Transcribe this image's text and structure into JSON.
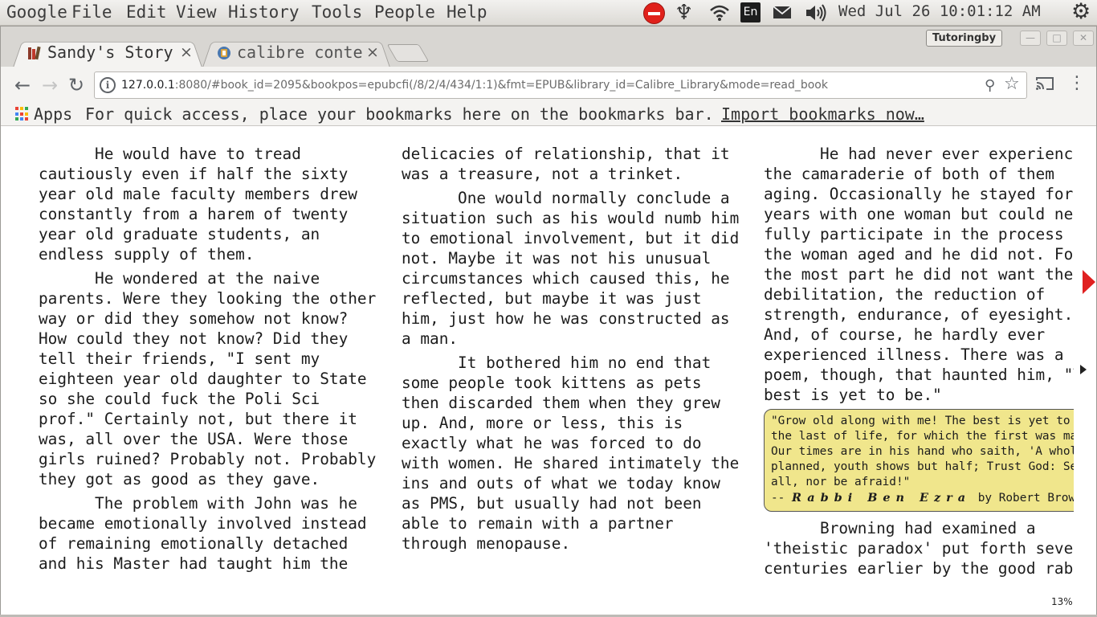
{
  "topbar": {
    "menus": [
      "Google",
      "File",
      "Edit",
      "View",
      "History",
      "Tools",
      "People",
      "Help"
    ],
    "keyboard_layout": "En",
    "clock": "Wed Jul 26 10:01:12 AM",
    "icons": [
      "stop-sign-icon",
      "sync-icon",
      "wifi-icon",
      "keyboard-layout-indicator",
      "mail-icon",
      "volume-icon",
      "system-gear-icon"
    ],
    "stop_color": "#e0211b"
  },
  "tabs": [
    {
      "title": "Sandy's Story",
      "close": "×",
      "active": true,
      "icon": "books-icon"
    },
    {
      "title": "calibre content server",
      "close": "×",
      "active": false,
      "icon": "calibre-icon"
    }
  ],
  "profile_badge": "Tutoringby",
  "window_buttons": {
    "minimize": "—",
    "maximize": "□",
    "close": "✕"
  },
  "toolbar": {
    "url_host": "127.0.0.1",
    "url_rest": ":8080/#book_id=2095&bookpos=epubcfi(/8/2/4/434/1:1)&fmt=EPUB&library_id=Calibre_Library&mode=read_book"
  },
  "bookmarks": {
    "apps_label": "Apps",
    "hint": "For quick access, place your bookmarks here on the bookmarks bar.",
    "import_link": "Import bookmarks now…",
    "apps_colors": [
      "#ea4335",
      "#fbbc05",
      "#34a853",
      "#4285f4",
      "#ea4335",
      "#fbbc05",
      "#34a853",
      "#4285f4",
      "#ea4335"
    ]
  },
  "reader": {
    "col1": [
      [
        "      He would have to tread",
        "cautiously even if half the sixty",
        "year old male faculty members drew",
        "constantly from a harem of twenty",
        "year old graduate students, an",
        "endless supply of them."
      ],
      [
        "      He wondered at the naive",
        "parents. Were they looking the other",
        "way or did they somehow not know?",
        "How could they not know? Did they",
        "tell their friends, \"I sent my",
        "eighteen year old daughter to State",
        "so she could fuck the Poli Sci",
        "prof.\" Certainly not, but there it",
        "was, all over the USA. Were those",
        "girls ruined? Probably not. Probably",
        "they got as good as they gave."
      ],
      [
        "      The problem with John was he",
        "became emotionally involved instead",
        "of remaining emotionally detached",
        "and his Master had taught him the"
      ]
    ],
    "col2": [
      [
        "delicacies of relationship, that it",
        "was a treasure, not a trinket."
      ],
      [
        "      One would normally conclude a",
        "situation such as his would numb him",
        "to emotional involvement, but it did",
        "not. Maybe it was not his unusual",
        "circumstances which caused this, he",
        "reflected, but maybe it was just",
        "him, just how he was constructed as",
        "a man."
      ],
      [
        "      It bothered him no end that",
        "some people took kittens as pets",
        "then discarded them when they grew",
        "up. And, more or less, this is",
        "exactly what he was forced to do",
        "with women. He shared intimately the",
        "ins and outs of what we today know",
        "as PMS, but usually had not been",
        "able to remain with a partner",
        "through menopause."
      ]
    ],
    "col3_before": [
      [
        "      He had never ever experienced",
        "the camaraderie of both of them",
        "aging. Occasionally he stayed for",
        "years with one woman but could neve",
        "fully participate in the process fo",
        "the woman aged and he did not. For",
        "the most part he did not want the",
        "debilitation, the reduction of",
        "strength, endurance, of eyesight.",
        "And, of course, he hardly ever",
        "experienced illness. There was a",
        "poem, though, that haunted him, \"Th",
        "best is yet to be.\""
      ]
    ],
    "quote_lines": [
      "\"Grow old along with me! The best is yet to be,",
      "the last of life, for which the first was made.",
      "Our times are in his hand who saith, 'A whole I",
      "planned, youth shows but half; Trust God: See",
      "all, nor be afraid!\""
    ],
    "quote_attrib_prefix": "-- ",
    "quote_attrib_name": "Rabbi Ben Ezra",
    "quote_attrib_suffix": " by Robert Browning",
    "quote_bg": "#f0e68c",
    "col3_after": [
      [
        "      Browning had examined a",
        "'theistic paradox' put forth severa",
        "centuries earlier by the good rabbi"
      ]
    ],
    "progress": "13%"
  }
}
